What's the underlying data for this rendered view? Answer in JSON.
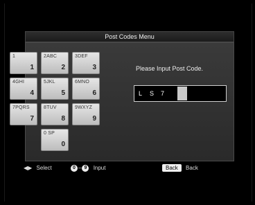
{
  "menu": {
    "title": "Post Codes Menu"
  },
  "keypad": {
    "keys": [
      {
        "letters": "1",
        "digit": "1"
      },
      {
        "letters": "2ABC",
        "digit": "2"
      },
      {
        "letters": "3DEF",
        "digit": "3"
      },
      {
        "letters": "4GHI",
        "digit": "4"
      },
      {
        "letters": "5JKL",
        "digit": "5"
      },
      {
        "letters": "6MNO",
        "digit": "6"
      },
      {
        "letters": "7PQRS",
        "digit": "7"
      },
      {
        "letters": "8TUV",
        "digit": "8"
      },
      {
        "letters": "9WXYZ",
        "digit": "9"
      },
      {
        "letters": "0 SP",
        "digit": "0"
      }
    ]
  },
  "prompt": "Please Input Post Code.",
  "entry": {
    "chars": [
      "L",
      "S",
      "7"
    ]
  },
  "footer": {
    "select_label": "Select",
    "range_start": "0",
    "range_sep": "–",
    "range_end": "9",
    "input_label": "Input",
    "back_button": "Back",
    "back_label": "Back"
  }
}
